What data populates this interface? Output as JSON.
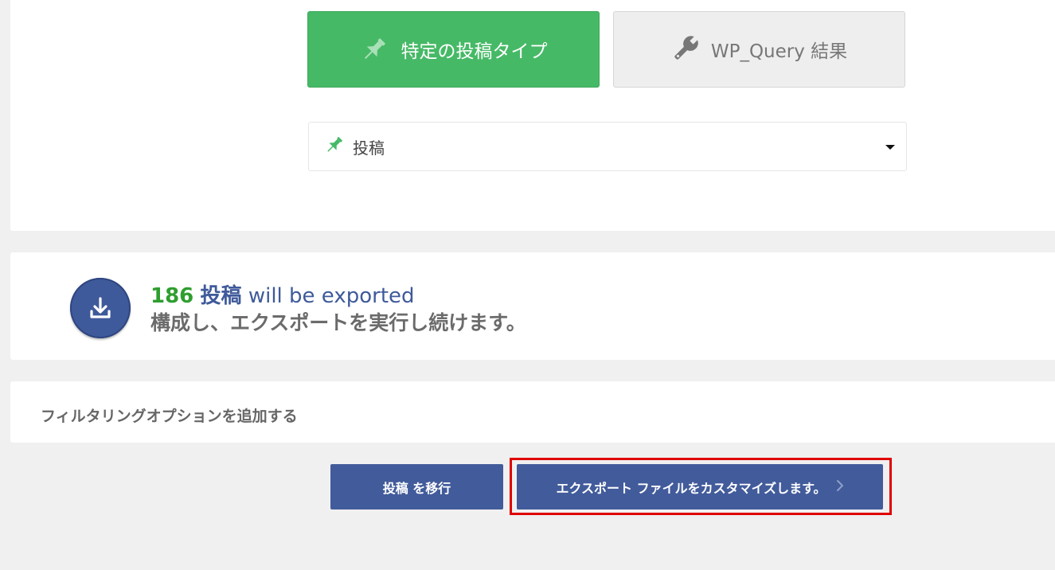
{
  "type_selector": {
    "specific_label": "特定の投稿タイプ",
    "wpquery_label": "WP_Query 結果"
  },
  "post_select": {
    "selected": "投稿"
  },
  "export_summary": {
    "count": "186",
    "post_type": "投稿",
    "suffix": " will be exported",
    "subtitle": "構成し、エクスポートを実行し続けます。"
  },
  "filter": {
    "title": "フィルタリングオプションを追加する"
  },
  "actions": {
    "migrate_label": "投稿 を移行",
    "customize_label": "エクスポート ファイルをカスタマイズします。",
    "customize_icon": "chevron-right-icon"
  },
  "colors": {
    "green": "#46b966",
    "blue": "#425b9b",
    "count_green": "#2e9e2e",
    "highlight_red": "#e00000"
  }
}
